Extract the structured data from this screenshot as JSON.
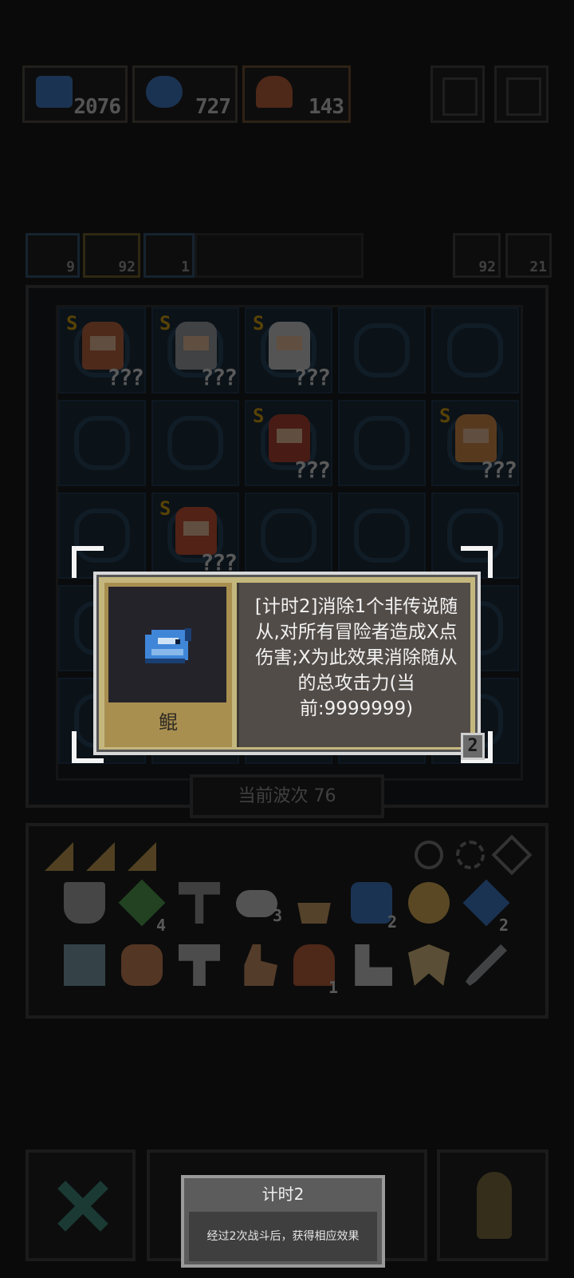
{
  "resources": [
    {
      "name": "fish-resource",
      "value": "2076",
      "color": "#3a78c9"
    },
    {
      "name": "squirrel-resource",
      "value": "727",
      "color": "#3a78c9"
    },
    {
      "name": "hero-resource",
      "value": "143",
      "color": "#c05a30"
    }
  ],
  "stats": [
    {
      "value": "9"
    },
    {
      "value": "92"
    },
    {
      "value": "1"
    },
    {
      "value": "92"
    },
    {
      "value": "21"
    }
  ],
  "board": {
    "units": [
      {
        "tier": "S",
        "hp": "???"
      },
      {
        "tier": "S",
        "hp": "???"
      },
      {
        "tier": "S",
        "hp": "???"
      },
      {
        "tier": "S",
        "hp": "???"
      },
      {
        "tier": "S",
        "hp": "???"
      },
      {
        "tier": "S",
        "hp": "???"
      }
    ],
    "wave_label": "当前波次 76"
  },
  "inventory": {
    "items": [
      {
        "icon": "shield-icon",
        "count": ""
      },
      {
        "icon": "gem-icon",
        "count": "4"
      },
      {
        "icon": "hammer-icon",
        "count": ""
      },
      {
        "icon": "cloud-icon",
        "count": "3"
      },
      {
        "icon": "ship-icon",
        "count": ""
      },
      {
        "icon": "fish-icon",
        "count": "2"
      },
      {
        "icon": "gear-icon",
        "count": ""
      },
      {
        "icon": "potion-icon",
        "count": "2"
      },
      {
        "icon": "cart-icon",
        "count": ""
      },
      {
        "icon": "creature-icon",
        "count": ""
      },
      {
        "icon": "anvil-icon",
        "count": ""
      },
      {
        "icon": "finger-icon",
        "count": ""
      },
      {
        "icon": "hero-icon",
        "count": "1"
      },
      {
        "icon": "boot-icon",
        "count": ""
      },
      {
        "icon": "wings-icon",
        "count": ""
      },
      {
        "icon": "sword-icon",
        "count": ""
      }
    ]
  },
  "popup": {
    "item_name": "鲲",
    "description": "[计时2]消除1个非传说随从,对所有冒险者造成X点伤害;X为此效果消除随从的总攻击力(当前:9999999)",
    "badge": "2"
  },
  "tooltip": {
    "title": "计时2",
    "body": "经过2次战斗后，获得相应效果"
  }
}
